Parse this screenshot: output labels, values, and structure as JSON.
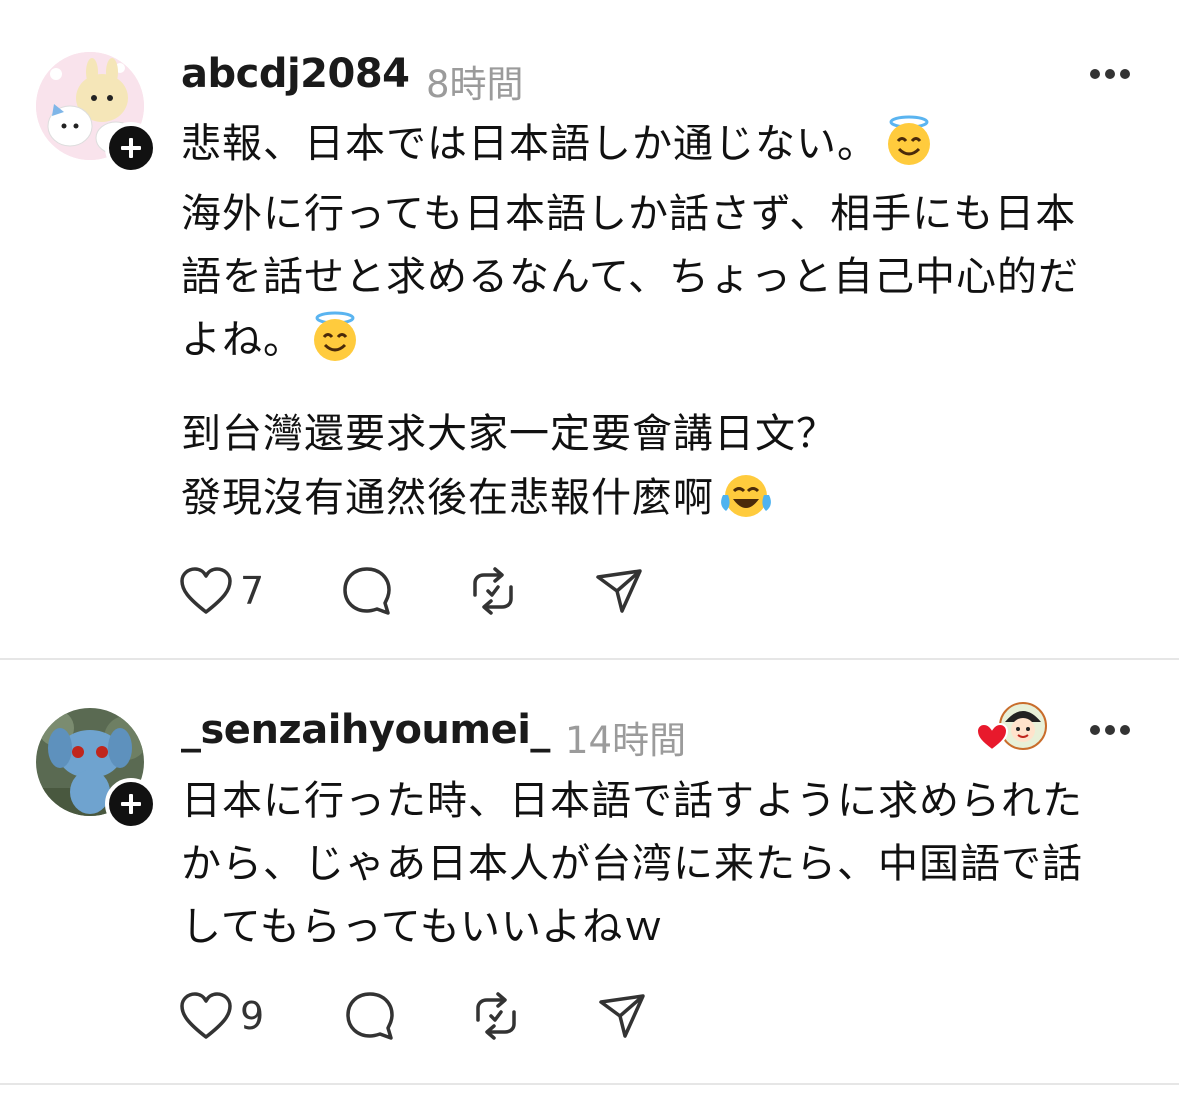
{
  "posts": [
    {
      "username": "abcdj2084",
      "time": "8時間",
      "lines": [
        "悲報、日本では日本語しか通じない。",
        "海外に行っても日本語しか話さず、相手にも日本",
        "語を話せと求めるなんて、ちょっと自己中心的だ",
        "よね。",
        "到台灣還要求大家一定要會講日文？",
        "發現沒有通然後在悲報什麼啊"
      ],
      "emojis": [
        "smiling-face-with-halo",
        "smiling-face-with-halo",
        "face-with-tears-of-joy"
      ],
      "likes": "7"
    },
    {
      "username": "_senzaihyoumei_",
      "time": "14時間",
      "lines": [
        "日本に行った時、日本語で話すように求められた",
        "から、じゃあ日本人が台湾に来たら、中国語で話",
        "してもらってもいいよねｗ"
      ],
      "likes": "9"
    }
  ],
  "colors": {
    "text": "#111111",
    "muted": "#9b9b9b",
    "divider": "#e6e6e6",
    "heart": "#e8192c"
  }
}
